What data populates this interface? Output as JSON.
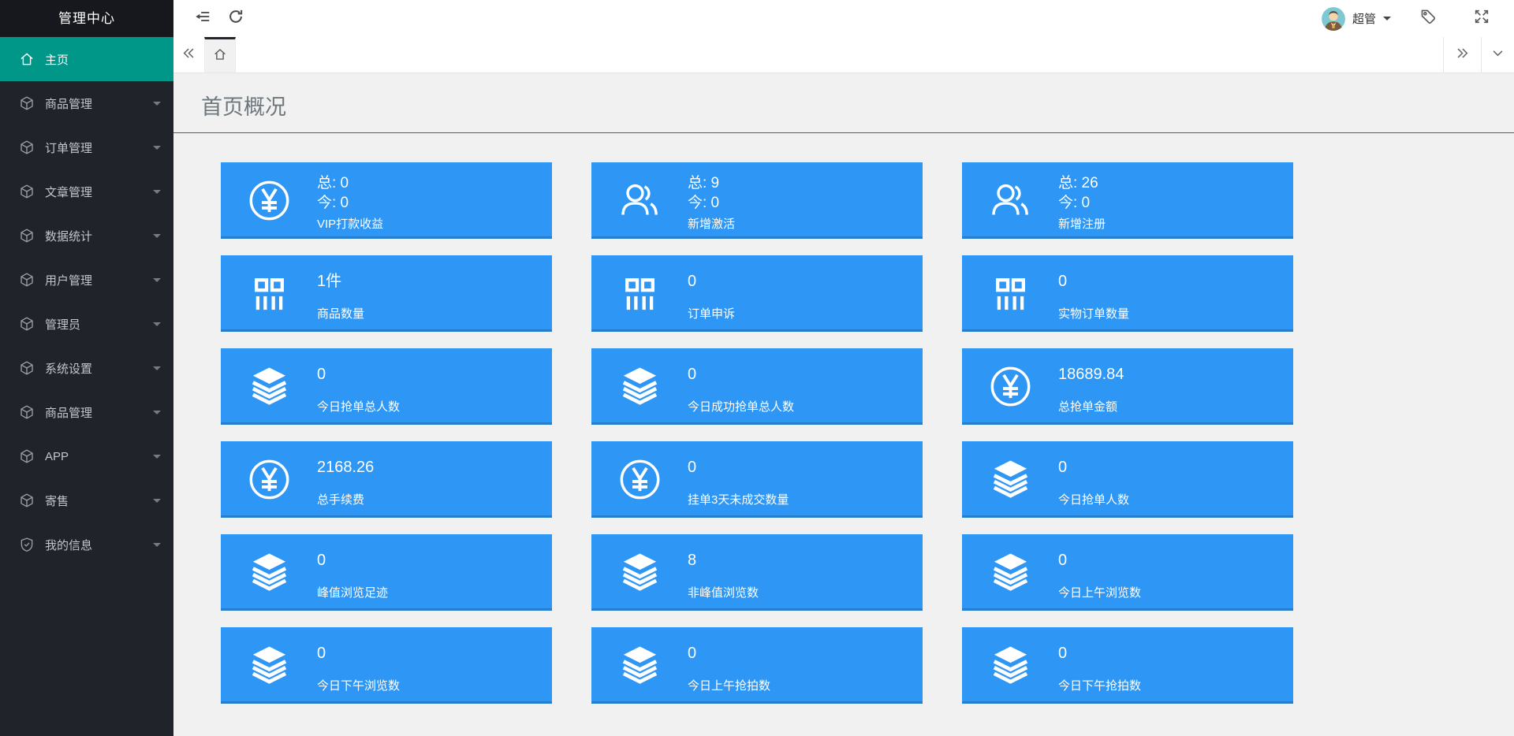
{
  "colors": {
    "card_blue": "#2e96f5",
    "sidebar_bg": "#20232a",
    "sidebar_active": "#009688",
    "content_bg": "#f1f1f2"
  },
  "sidebar": {
    "title": "管理中心",
    "items": [
      {
        "label": "主页",
        "icon": "home-icon",
        "active": true,
        "caret": false
      },
      {
        "label": "商品管理",
        "icon": "cube-icon",
        "active": false,
        "caret": true
      },
      {
        "label": "订单管理",
        "icon": "cube-icon",
        "active": false,
        "caret": true
      },
      {
        "label": "文章管理",
        "icon": "cube-icon",
        "active": false,
        "caret": true
      },
      {
        "label": "数据统计",
        "icon": "cube-icon",
        "active": false,
        "caret": true
      },
      {
        "label": "用户管理",
        "icon": "cube-icon",
        "active": false,
        "caret": true
      },
      {
        "label": "管理员",
        "icon": "cube-icon",
        "active": false,
        "caret": true
      },
      {
        "label": "系统设置",
        "icon": "cube-icon",
        "active": false,
        "caret": true
      },
      {
        "label": "商品管理",
        "icon": "cube-icon",
        "active": false,
        "caret": true
      },
      {
        "label": "APP",
        "icon": "cube-icon",
        "active": false,
        "caret": true
      },
      {
        "label": "寄售",
        "icon": "cube-icon",
        "active": false,
        "caret": true
      },
      {
        "label": "我的信息",
        "icon": "shield-check-icon",
        "active": false,
        "caret": true
      }
    ]
  },
  "topbar": {
    "left_icons": [
      "collapse-menu-icon",
      "refresh-icon"
    ],
    "user": {
      "name": "超管",
      "icons": [
        "avatar",
        "caret-down-icon"
      ]
    },
    "right_icons": [
      "tag-icon",
      "fullscreen-icon"
    ]
  },
  "tabbar": {
    "left_icon": "chevrons-left-icon",
    "active_tab_icon": "home-icon",
    "right_icons": [
      "chevrons-right-icon",
      "chevron-down-icon"
    ]
  },
  "page": {
    "title": "首页概况"
  },
  "cards": [
    {
      "icon": "yen-circle-icon",
      "lines": [
        "总: 0",
        "今: 0"
      ],
      "label": "VIP打款收益"
    },
    {
      "icon": "users-icon",
      "lines": [
        "总: 9",
        "今: 0"
      ],
      "label": "新增激活"
    },
    {
      "icon": "users-icon",
      "lines": [
        "总: 26",
        "今: 0"
      ],
      "label": "新增注册"
    },
    {
      "icon": "goods-icon",
      "value": "1件",
      "label": "商品数量"
    },
    {
      "icon": "goods-icon",
      "value": "0",
      "label": "订单申诉"
    },
    {
      "icon": "goods-icon",
      "value": "0",
      "label": "实物订单数量"
    },
    {
      "icon": "layers-icon",
      "value": "0",
      "label": "今日抢单总人数"
    },
    {
      "icon": "layers-icon",
      "value": "0",
      "label": "今日成功抢单总人数"
    },
    {
      "icon": "yen-circle-icon",
      "value": "18689.84",
      "label": "总抢单金额"
    },
    {
      "icon": "yen-circle-icon",
      "value": "2168.26",
      "label": "总手续费"
    },
    {
      "icon": "yen-circle-icon",
      "value": "0",
      "label": "挂单3天未成交数量"
    },
    {
      "icon": "layers-icon",
      "value": "0",
      "label": "今日抢单人数"
    },
    {
      "icon": "layers-icon",
      "value": "0",
      "label": "峰值浏览足迹"
    },
    {
      "icon": "layers-icon",
      "value": "8",
      "label": "非峰值浏览数"
    },
    {
      "icon": "layers-icon",
      "value": "0",
      "label": "今日上午浏览数"
    },
    {
      "icon": "layers-icon",
      "value": "0",
      "label": "今日下午浏览数"
    },
    {
      "icon": "layers-icon",
      "value": "0",
      "label": "今日上午抢拍数"
    },
    {
      "icon": "layers-icon",
      "value": "0",
      "label": "今日下午抢拍数"
    }
  ]
}
